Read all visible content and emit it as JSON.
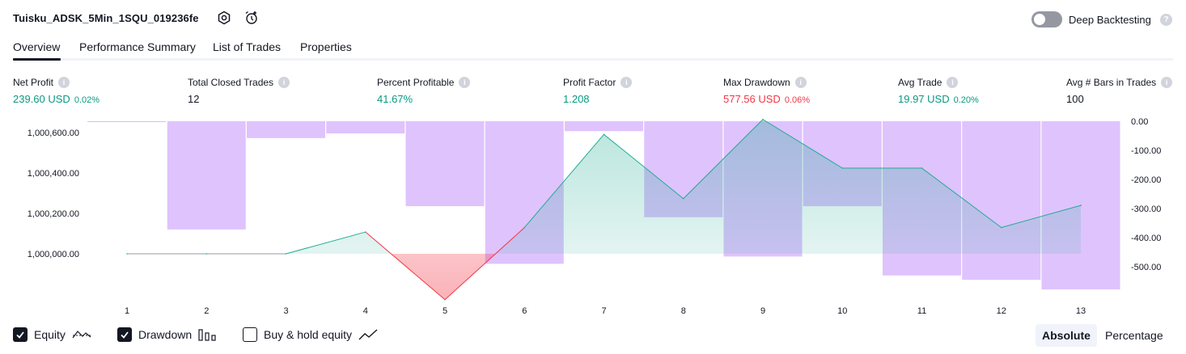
{
  "header": {
    "title": "Tuisku_ADSK_5Min_1SQU_019236fe",
    "settings_icon": "gear-icon",
    "alert_icon": "alarm-clock-add-icon",
    "deep_backtesting_label": "Deep Backtesting",
    "deep_backtesting_enabled": false,
    "help_icon": "question-icon",
    "help_text": "?"
  },
  "tabs": [
    {
      "label": "Overview",
      "active": true
    },
    {
      "label": "Performance Summary",
      "active": false
    },
    {
      "label": "List of Trades",
      "active": false
    },
    {
      "label": "Properties",
      "active": false
    }
  ],
  "metrics": [
    {
      "label": "Net Profit",
      "value": "239.60 USD",
      "pct": "0.02%",
      "color": "#089981"
    },
    {
      "label": "Total Closed Trades",
      "value": "12",
      "pct": "",
      "color": "#131722"
    },
    {
      "label": "Percent Profitable",
      "value": "41.67%",
      "pct": "",
      "color": "#089981"
    },
    {
      "label": "Profit Factor",
      "value": "1.208",
      "pct": "",
      "color": "#089981"
    },
    {
      "label": "Max Drawdown",
      "value": "577.56 USD",
      "pct": "0.06%",
      "color": "#f23645"
    },
    {
      "label": "Avg Trade",
      "value": "19.97 USD",
      "pct": "0.20%",
      "color": "#089981"
    },
    {
      "label": "Avg # Bars in Trades",
      "value": "100",
      "pct": "",
      "color": "#131722"
    }
  ],
  "info_icon_text": "i",
  "chart_data": {
    "type": "line",
    "x": [
      1,
      2,
      3,
      4,
      5,
      6,
      7,
      8,
      9,
      10,
      11,
      12,
      13
    ],
    "series": [
      {
        "name": "Equity",
        "axis": "left",
        "values": [
          1000000.0,
          1000000.0,
          1000000.0,
          1000107.8,
          999773.0,
          1000129.6,
          1000590.6,
          1000273.0,
          1000665.0,
          1000424.0,
          1000424.0,
          1000130.0,
          1000239.6
        ]
      },
      {
        "name": "Drawdown",
        "axis": "right",
        "type": "bar",
        "values": [
          -3.0,
          -372.0,
          -58.0,
          -42.0,
          -292.0,
          -490.0,
          -34.0,
          -330.0,
          -465.0,
          -292.0,
          -530.0,
          -545.0,
          -578.0
        ]
      }
    ],
    "left_axis": {
      "ticks": [
        "1,000,600.00",
        "1,000,400.00",
        "1,000,200.00",
        "1,000,000.00"
      ],
      "tick_values": [
        1000600,
        1000400,
        1000200,
        1000000
      ]
    },
    "right_axis": {
      "ticks": [
        "0.00",
        "-100.00",
        "-200.00",
        "-300.00",
        "-400.00",
        "-500.00"
      ],
      "tick_values": [
        0,
        -100,
        -200,
        -300,
        -400,
        -500
      ]
    },
    "x_ticks": [
      "1",
      "2",
      "3",
      "4",
      "5",
      "6",
      "7",
      "8",
      "9",
      "10",
      "11",
      "12",
      "13"
    ],
    "colors": {
      "equity_line_up": "#22ab94",
      "equity_line_base": "#9598a1",
      "equity_fill_up": "#22ab94",
      "equity_fill_down": "#f23645",
      "drawdown_bar": "#d7b4fd",
      "drawdown_line": "#e3c8ff"
    },
    "grid": false
  },
  "legend": [
    {
      "label": "Equity",
      "checked": true,
      "icon": "equity-line-icon"
    },
    {
      "label": "Drawdown",
      "checked": true,
      "icon": "bar-chart-icon"
    },
    {
      "label": "Buy & hold equity",
      "checked": false,
      "icon": "line-chart-icon"
    }
  ],
  "scale_toggle": {
    "absolute": "Absolute",
    "percentage": "Percentage",
    "selected": "absolute"
  }
}
